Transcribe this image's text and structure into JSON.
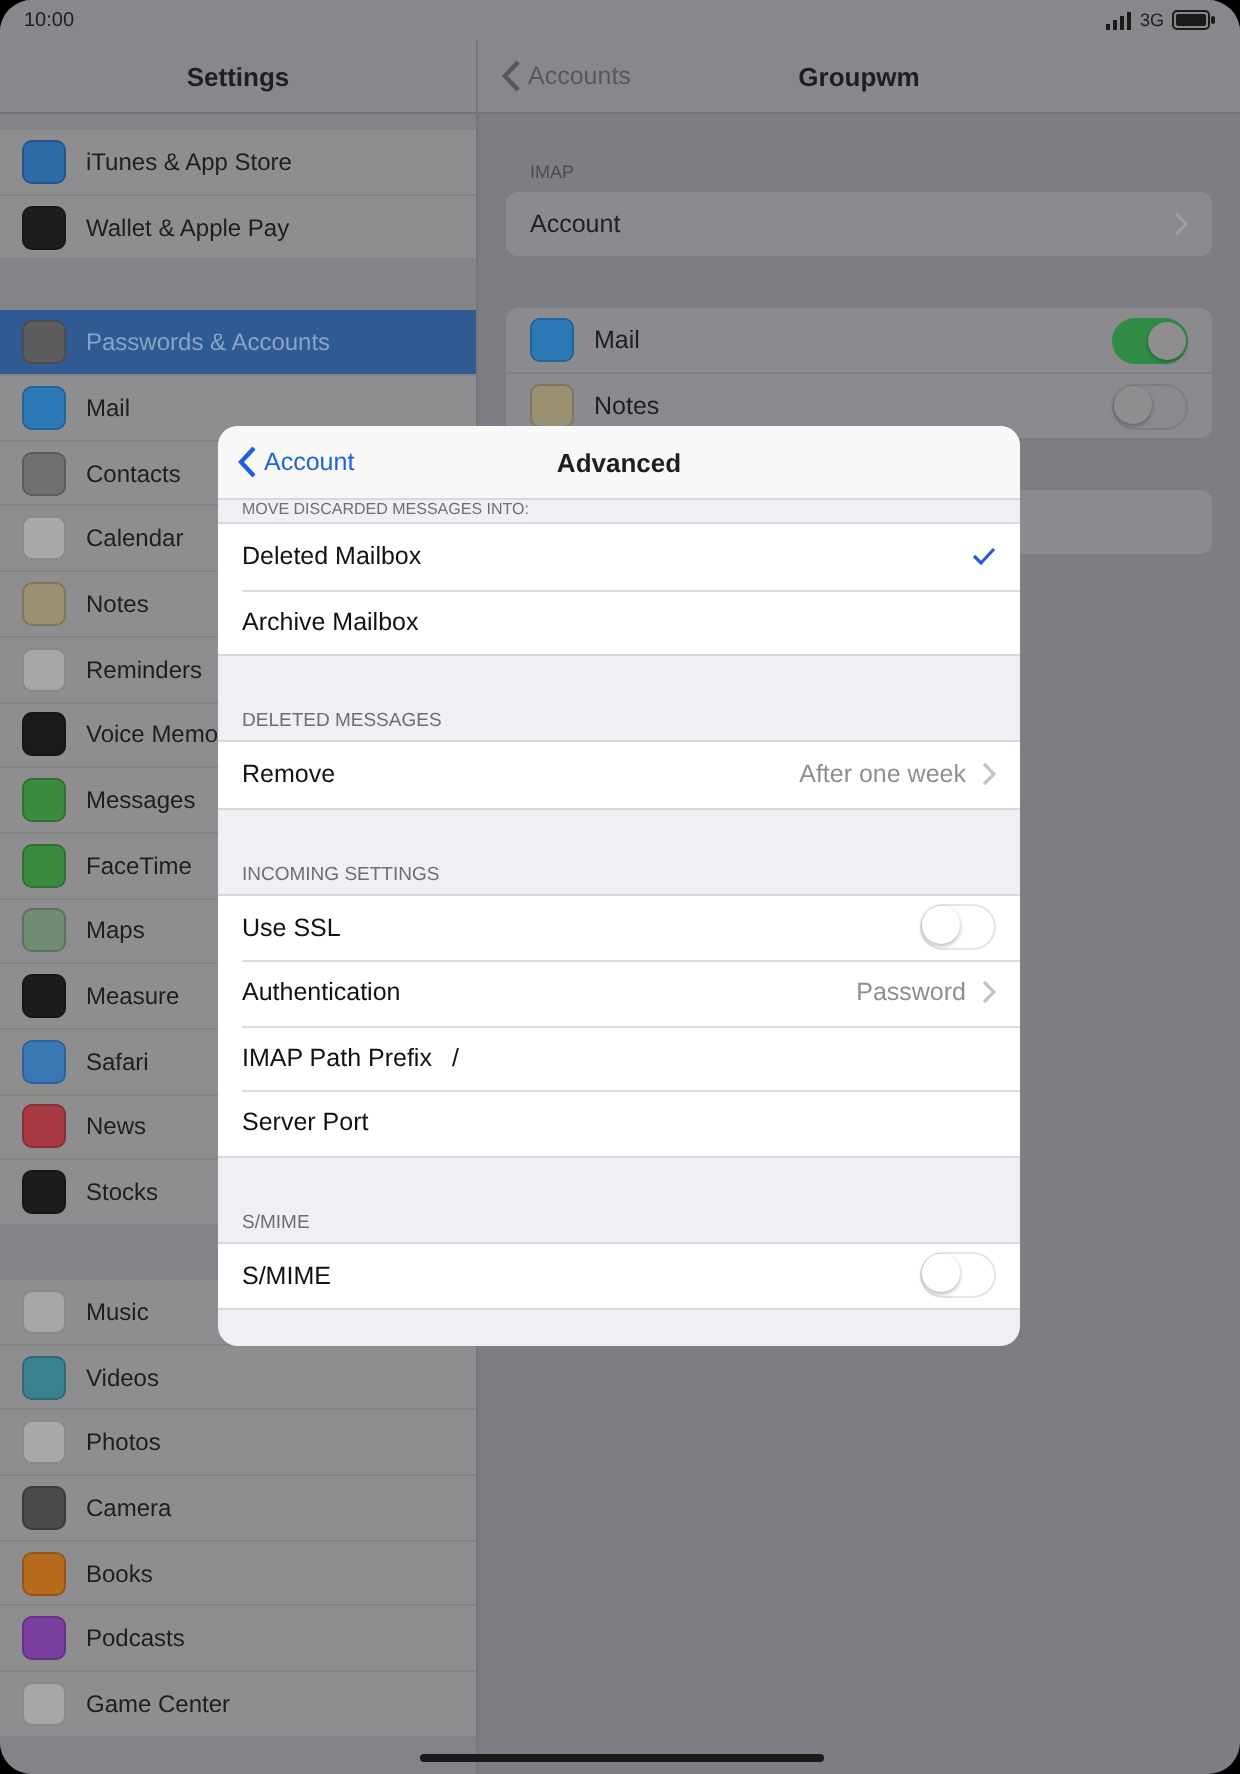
{
  "status_bar": {
    "time": "10:00",
    "network": "3G"
  },
  "sidebar": {
    "title": "Settings",
    "groups": [
      {
        "items": [
          {
            "label": "iTunes & App Store",
            "color": "#2c6aa8",
            "selected": false
          },
          {
            "label": "Wallet & Apple Pay",
            "color": "#1e1e1e",
            "selected": false
          }
        ]
      },
      {
        "items": [
          {
            "label": "Passwords & Accounts",
            "color": "#5d5d60",
            "selected": true
          },
          {
            "label": "Mail",
            "color": "#2d79b8",
            "selected": false
          },
          {
            "label": "Contacts",
            "color": "#707073",
            "selected": false
          },
          {
            "label": "Calendar",
            "color": "#a9a9ac",
            "selected": false
          },
          {
            "label": "Notes",
            "color": "#9a9172",
            "selected": false
          },
          {
            "label": "Reminders",
            "color": "#a6a6a9",
            "selected": false
          },
          {
            "label": "Voice Memo",
            "color": "#1a1a1a",
            "selected": false
          },
          {
            "label": "Messages",
            "color": "#3a8a3f",
            "selected": false
          },
          {
            "label": "FaceTime",
            "color": "#3a8a3f",
            "selected": false
          },
          {
            "label": "Maps",
            "color": "#6f8d72",
            "selected": false
          },
          {
            "label": "Measure",
            "color": "#1c1c1c",
            "selected": false
          },
          {
            "label": "Safari",
            "color": "#3a78b5",
            "selected": false
          },
          {
            "label": "News",
            "color": "#a83a44",
            "selected": false
          },
          {
            "label": "Stocks",
            "color": "#1c1c1c",
            "selected": false
          }
        ]
      },
      {
        "items": [
          {
            "label": "Music",
            "color": "#a6a6a9",
            "selected": false
          },
          {
            "label": "Videos",
            "color": "#3a8190",
            "selected": false
          },
          {
            "label": "Photos",
            "color": "#a8a8ab",
            "selected": false
          },
          {
            "label": "Camera",
            "color": "#4a4a4c",
            "selected": false
          },
          {
            "label": "Books",
            "color": "#b56a1e",
            "selected": false
          },
          {
            "label": "Podcasts",
            "color": "#7a3fa0",
            "selected": false
          },
          {
            "label": "Game Center",
            "color": "#a7a7aa",
            "selected": false
          }
        ]
      }
    ]
  },
  "detail": {
    "back": "Accounts",
    "title": "Groupwm",
    "sections": [
      {
        "header": "IMAP",
        "rows": [
          {
            "kind": "link",
            "label": "Account"
          }
        ]
      },
      {
        "rows": [
          {
            "kind": "toggle",
            "label": "Mail",
            "color": "#2d79b8",
            "on": true
          },
          {
            "kind": "toggle",
            "label": "Notes",
            "color": "#9a9172",
            "on": false
          }
        ]
      },
      {
        "rows": [
          {
            "kind": "blank"
          }
        ]
      }
    ]
  },
  "modal": {
    "back": "Account",
    "title": "Advanced",
    "sections": [
      {
        "header": "MOVE DISCARDED MESSAGES INTO:",
        "rows": [
          {
            "kind": "choice",
            "label": "Deleted Mailbox",
            "selected": true
          },
          {
            "kind": "choice",
            "label": "Archive Mailbox",
            "selected": false
          }
        ]
      },
      {
        "header": "DELETED MESSAGES",
        "rows": [
          {
            "kind": "link",
            "label": "Remove",
            "value": "After one week"
          }
        ]
      },
      {
        "header": "INCOMING SETTINGS",
        "rows": [
          {
            "kind": "toggle",
            "label": "Use SSL",
            "on": false
          },
          {
            "kind": "link",
            "label": "Authentication",
            "value": "Password"
          },
          {
            "kind": "field",
            "label": "IMAP Path Prefix",
            "value": "/"
          },
          {
            "kind": "field",
            "label": "Server Port"
          }
        ]
      },
      {
        "header": "S/MIME",
        "rows": [
          {
            "kind": "toggle",
            "label": "S/MIME",
            "on": false
          }
        ]
      }
    ]
  }
}
